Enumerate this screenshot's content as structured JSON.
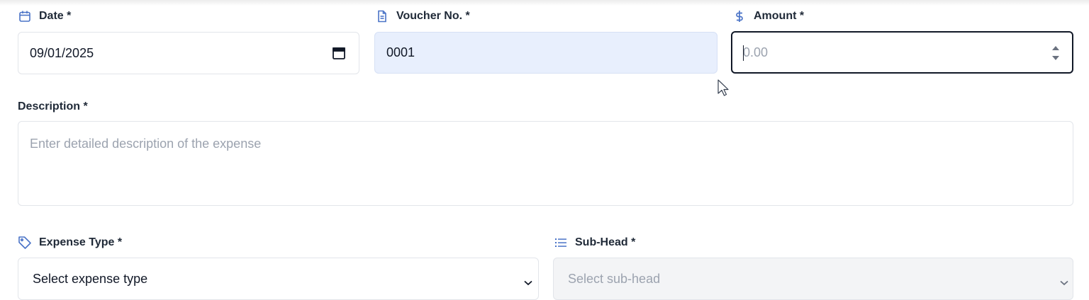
{
  "form": {
    "date": {
      "label": "Date *",
      "value": "09/01/2025",
      "icon": "calendar-icon"
    },
    "voucher": {
      "label": "Voucher No. *",
      "value": "0001",
      "icon": "document-icon"
    },
    "amount": {
      "label": "Amount *",
      "placeholder": "0.00",
      "icon": "dollar-icon"
    },
    "description": {
      "label": "Description *",
      "placeholder": "Enter detailed description of the expense"
    },
    "expense_type": {
      "label": "Expense Type *",
      "placeholder": "Select expense type",
      "icon": "tag-icon"
    },
    "sub_head": {
      "label": "Sub-Head *",
      "placeholder": "Select sub-head",
      "icon": "list-icon"
    }
  },
  "colors": {
    "accent": "#4a73c7",
    "voucher_bg": "#e8effd",
    "focus_border": "#111827",
    "placeholder": "#9ca3af",
    "disabled_bg": "#f3f4f6"
  }
}
